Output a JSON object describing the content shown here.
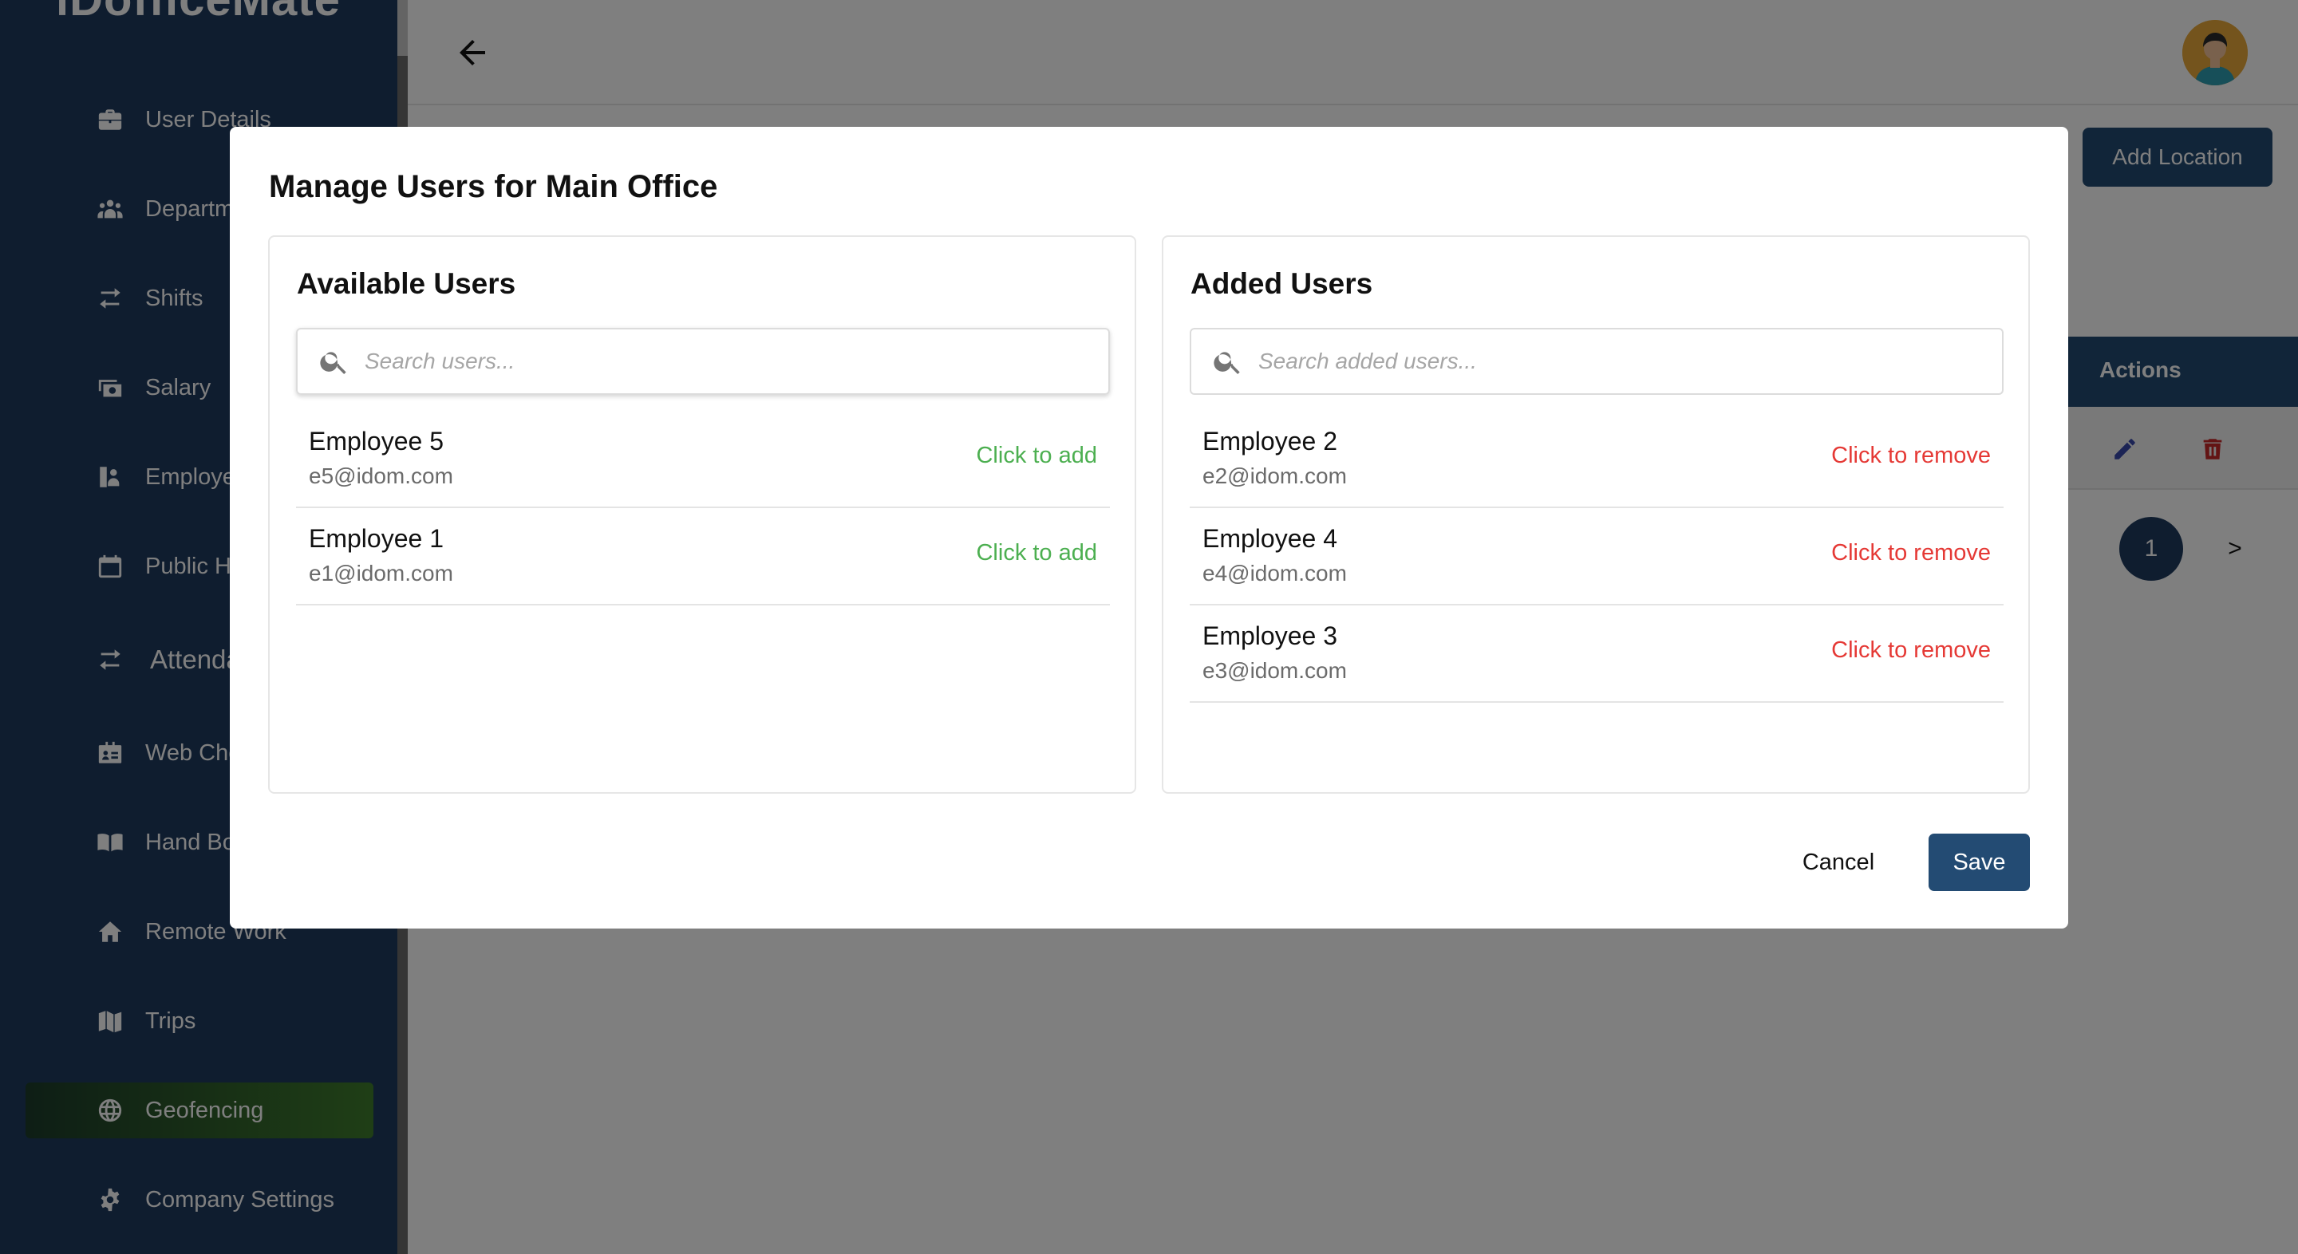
{
  "app": {
    "brand": "iDofficeMate"
  },
  "sidebar": {
    "items": [
      {
        "label": "User Details",
        "icon": "briefcase-icon"
      },
      {
        "label": "Departments",
        "icon": "users-group-icon"
      },
      {
        "label": "Shifts",
        "icon": "swap-arrows-icon"
      },
      {
        "label": "Salary",
        "icon": "money-icon"
      },
      {
        "label": "Employees",
        "icon": "employee-icon"
      },
      {
        "label": "Public Holidays",
        "icon": "calendar-icon"
      },
      {
        "label": "Attendance",
        "icon": "swap-arrows-icon"
      },
      {
        "label": "Web Check-in",
        "icon": "id-card-icon"
      },
      {
        "label": "Hand Book",
        "icon": "book-open-icon"
      },
      {
        "label": "Remote Work",
        "icon": "home-icon"
      },
      {
        "label": "Trips",
        "icon": "map-icon"
      },
      {
        "label": "Geofencing",
        "icon": "globe-icon",
        "active": true
      },
      {
        "label": "Company Settings",
        "icon": "gear-icon"
      }
    ]
  },
  "header": {
    "back_icon": "arrow-left-icon",
    "avatar_icon": "user-avatar-icon"
  },
  "page": {
    "add_location_label": "Add Location",
    "table": {
      "actions_header": "Actions"
    },
    "pagination": {
      "current_page": "1",
      "next_label": ">"
    }
  },
  "modal": {
    "title": "Manage Users for Main Office",
    "available": {
      "title": "Available Users",
      "search_placeholder": "Search users...",
      "users": [
        {
          "name": "Employee 5",
          "email": "e5@idom.com",
          "action": "Click to add"
        },
        {
          "name": "Employee 1",
          "email": "e1@idom.com",
          "action": "Click to add"
        }
      ]
    },
    "added": {
      "title": "Added Users",
      "search_placeholder": "Search added users...",
      "users": [
        {
          "name": "Employee 2",
          "email": "e2@idom.com",
          "action": "Click to remove"
        },
        {
          "name": "Employee 4",
          "email": "e4@idom.com",
          "action": "Click to remove"
        },
        {
          "name": "Employee 3",
          "email": "e3@idom.com",
          "action": "Click to remove"
        }
      ]
    },
    "cancel_label": "Cancel",
    "save_label": "Save"
  },
  "colors": {
    "sidebar_bg": "#1f3a5f",
    "primary": "#234b73",
    "active_gradient_start": "#1c3c2a",
    "active_gradient_end": "#3f7d2c",
    "add_action": "#4caf50",
    "remove_action": "#e53935",
    "delete_icon": "#c62828",
    "edit_icon": "#3949ab"
  }
}
